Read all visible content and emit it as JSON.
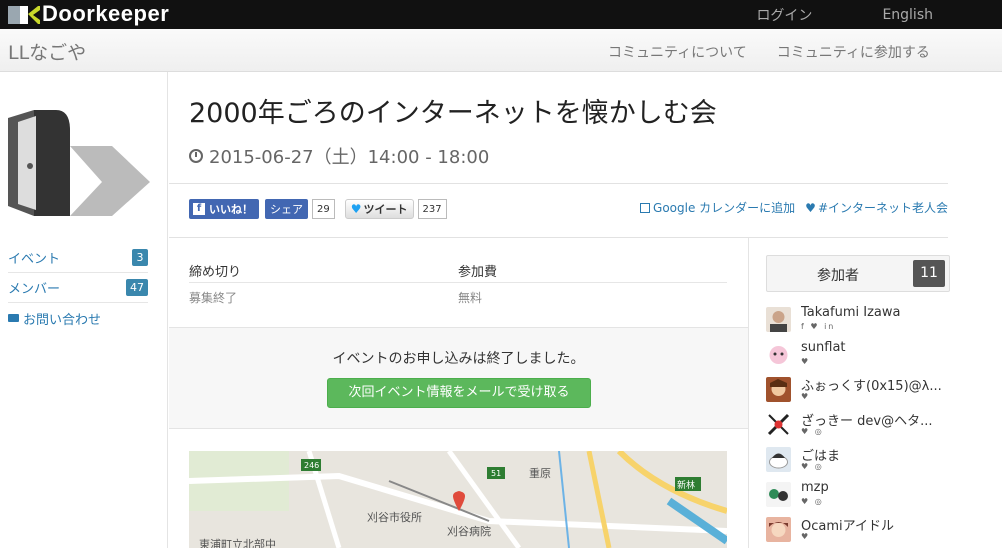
{
  "topbar": {
    "brand": "Doorkeeper",
    "links": [
      "ログイン",
      "English"
    ]
  },
  "community": {
    "name": "LLなごや",
    "links": [
      "コミュニティについて",
      "コミュニティに参加する"
    ]
  },
  "sidebar": {
    "items": [
      {
        "label": "イベント",
        "badge": "3"
      },
      {
        "label": "メンバー",
        "badge": "47"
      },
      {
        "label": "お問い合わせ"
      }
    ]
  },
  "event": {
    "title": "2000年ごろのインターネットを懐かしむ会",
    "datetime": "2015-06-27（土）14:00 - 18:00"
  },
  "social": {
    "fb_like": "いいね！",
    "fb_share": "シェア",
    "fb_count": "29",
    "tweet": "ツイート",
    "tweet_count": "237",
    "calendar": "Google カレンダーに追加",
    "hashtag": "#インターネット老人会"
  },
  "info": {
    "headers": [
      "締め切り",
      "参加費"
    ],
    "values": [
      "募集終了",
      "無料"
    ]
  },
  "apply": {
    "message": "イベントのお申し込みは終了しました。",
    "button": "次回イベント情報をメールで受け取る"
  },
  "map": {
    "labels": [
      "246",
      "51",
      "重原",
      "刈谷市役所",
      "刈谷病院",
      "新林",
      "東浦町立北部中"
    ]
  },
  "attendees": {
    "title": "参加者",
    "count": "11",
    "list": [
      {
        "name": "Takafumi Izawa",
        "icons": "f ♥ in"
      },
      {
        "name": "sunflat",
        "icons": "♥"
      },
      {
        "name": "ふぉっくす(0x15)@λ...",
        "icons": "♥"
      },
      {
        "name": "ざっきー dev@ヘタ...",
        "icons": "♥ ◎"
      },
      {
        "name": "ごはま",
        "icons": "♥ ◎"
      },
      {
        "name": "mzp",
        "icons": "♥ ◎"
      },
      {
        "name": "Ocamiアイドル",
        "icons": "♥"
      }
    ]
  },
  "colors": {
    "accent": "#2a7ab0",
    "button_green": "#5cb85c",
    "facebook": "#4267b2"
  }
}
